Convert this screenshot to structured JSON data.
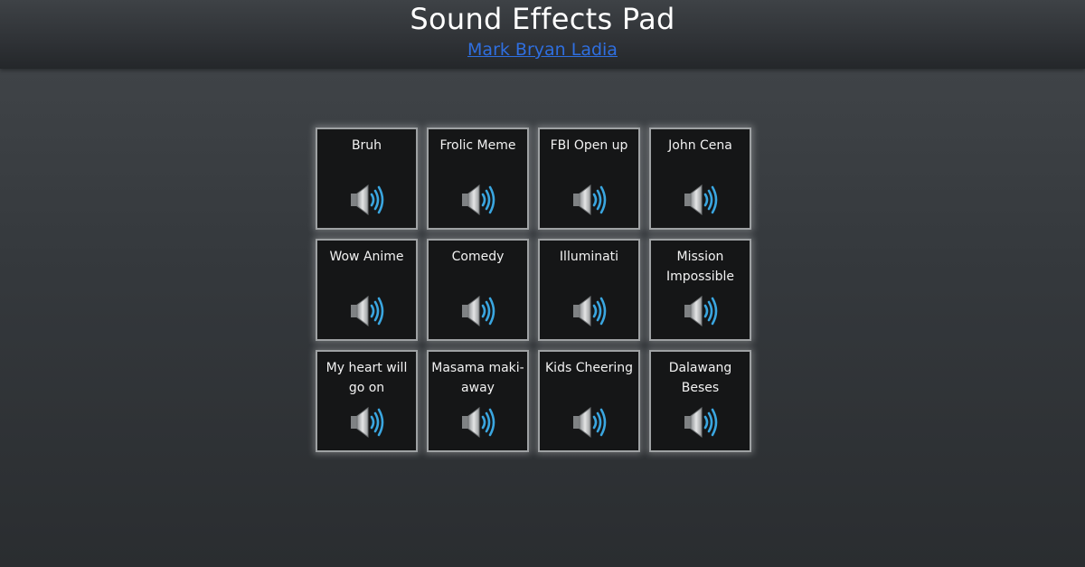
{
  "page": {
    "title": "Sound Effects Pad",
    "author": "Mark Bryan Ladia"
  },
  "pads": [
    {
      "label": "Bruh",
      "icon": "speaker-icon"
    },
    {
      "label": "Frolic Meme",
      "icon": "speaker-icon"
    },
    {
      "label": "FBI Open up",
      "icon": "speaker-icon"
    },
    {
      "label": "John Cena",
      "icon": "speaker-icon"
    },
    {
      "label": "Wow Anime",
      "icon": "speaker-icon"
    },
    {
      "label": "Comedy",
      "icon": "speaker-icon"
    },
    {
      "label": "Illuminati",
      "icon": "speaker-icon"
    },
    {
      "label": "Mission Impossible",
      "icon": "speaker-icon"
    },
    {
      "label": "My heart will go on",
      "icon": "speaker-icon"
    },
    {
      "label": "Masama maki-away",
      "icon": "speaker-icon"
    },
    {
      "label": "Kids Cheering",
      "icon": "speaker-icon"
    },
    {
      "label": "Dalawang Beses",
      "icon": "speaker-icon"
    }
  ],
  "colors": {
    "link": "#2f6fe0",
    "pad_background": "#151617",
    "speaker_waves": "#3aa6e0"
  }
}
